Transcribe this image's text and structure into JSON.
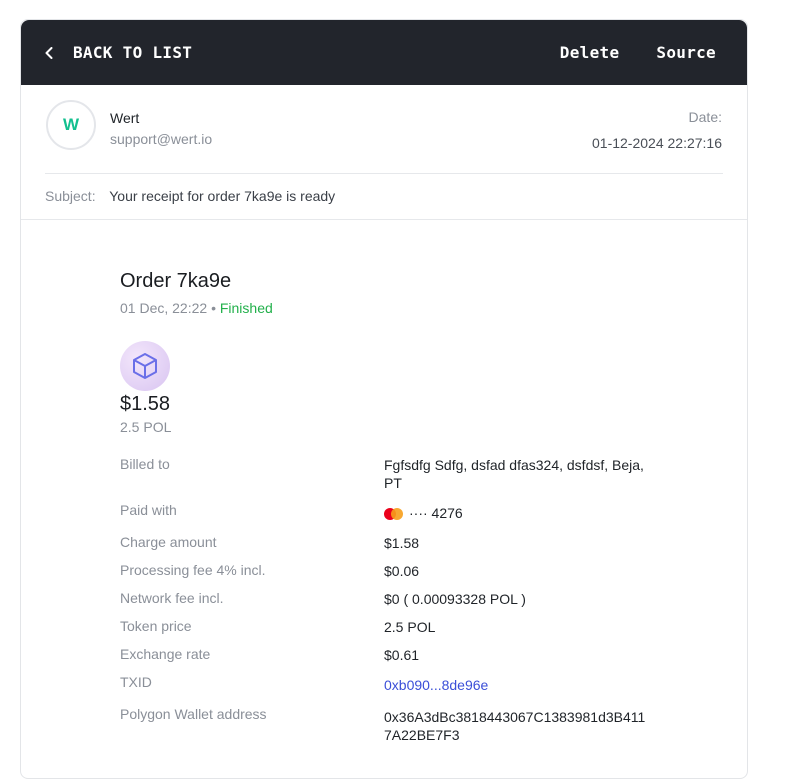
{
  "topbar": {
    "back_label": "BACK TO LIST",
    "delete_label": "Delete",
    "source_label": "Source"
  },
  "header": {
    "avatar_letter": "W",
    "from_name": "Wert",
    "from_email": "support@wert.io",
    "date_label": "Date:",
    "date_value": "01-12-2024 22:27:16",
    "subject_label": "Subject:",
    "subject": "Your receipt for order 7ka9e is ready"
  },
  "order": {
    "title": "Order 7ka9e",
    "datetime": "01 Dec, 22:22",
    "separator": "•",
    "status": "Finished",
    "amount": "$1.58",
    "amount_token": "2.5 POL",
    "token_icon": "polygon-cube-icon"
  },
  "details": {
    "billed_to": {
      "label": "Billed to",
      "value": "Fgfsdfg Sdfg, dsfad dfas324, dsfdsf, Beja, PT"
    },
    "paid_with": {
      "label": "Paid with",
      "value": "···· 4276",
      "icon": "mastercard-icon"
    },
    "charge_amount": {
      "label": "Charge amount",
      "value": "$1.58"
    },
    "processing_fee": {
      "label": "Processing fee 4% incl.",
      "value": "$0.06"
    },
    "network_fee": {
      "label": "Network fee incl.",
      "value": "$0 ( 0.00093328 POL )"
    },
    "token_price": {
      "label": "Token price",
      "value": "2.5 POL"
    },
    "exchange_rate": {
      "label": "Exchange rate",
      "value": "$0.61"
    },
    "txid": {
      "label": "TXID",
      "value": "0xb090...8de96e"
    },
    "wallet": {
      "label": "Polygon Wallet address",
      "value": "0x36A3dBc3818443067C1383981d3B4117A22BE7F3"
    }
  },
  "colors": {
    "topbar_bg": "#22252c",
    "status_green": "#22b04b",
    "link_blue": "#3b4fd8",
    "avatar_green": "#13c08f"
  }
}
